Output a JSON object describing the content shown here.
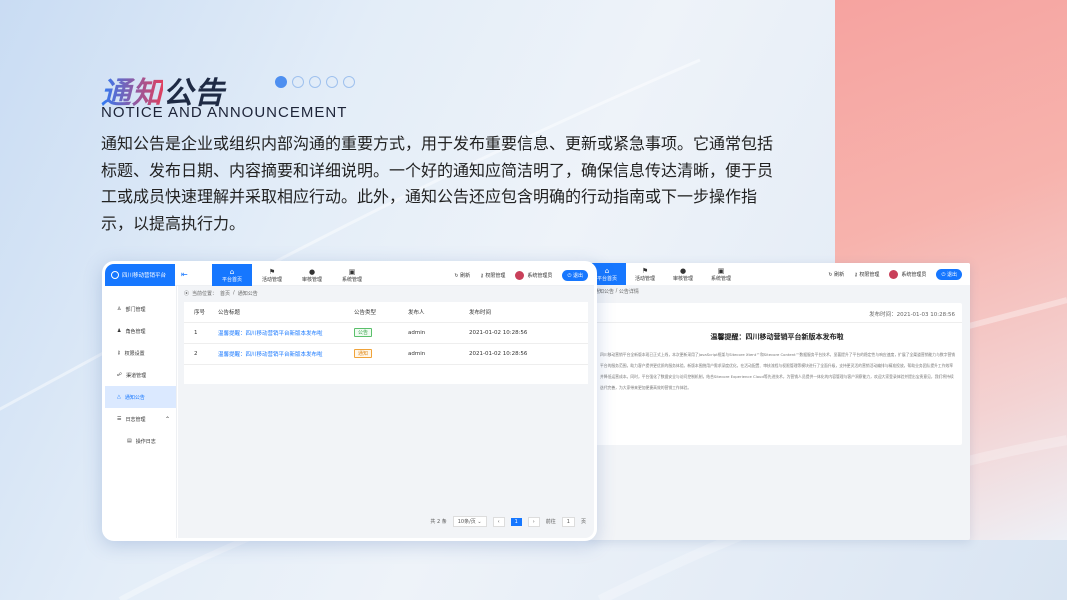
{
  "header": {
    "title_accent": "通知",
    "title_rest": "公告",
    "subtitle": "NOTICE AND ANNOUNCEMENT"
  },
  "description": "通知公告是企业或组织内部沟通的重要方式，用于发布重要信息、更新或紧急事项。它通常包括标题、发布日期、内容摘要和详细说明。一个好的通知应简洁明了，确保信息传达清晰，便于员工或成员快速理解并采取相应行动。此外，通知公告还应包含明确的行动指南或下一步操作指示，以提高执行力。",
  "app": {
    "logo": "四川移动营销平台",
    "nav": [
      {
        "label": "平台首页",
        "icon": "home-icon",
        "glyph": "⌂"
      },
      {
        "label": "活动管理",
        "icon": "flag-icon",
        "glyph": "⚑"
      },
      {
        "label": "审核管理",
        "icon": "user-icon",
        "glyph": "●"
      },
      {
        "label": "系统管理",
        "icon": "system-icon",
        "glyph": "▣"
      }
    ],
    "refresh": "刷新",
    "permission": "权限管理",
    "user": "系统管理员",
    "exit": "退出",
    "sidebar": [
      {
        "label": "部门管理",
        "icon": "org-icon",
        "glyph": "♙"
      },
      {
        "label": "角色管理",
        "icon": "role-icon",
        "glyph": "♟"
      },
      {
        "label": "权限设置",
        "icon": "key-icon",
        "glyph": "⚷"
      },
      {
        "label": "渠道管理",
        "icon": "channel-icon",
        "glyph": "☍"
      },
      {
        "label": "通知公告",
        "icon": "bell-icon",
        "glyph": "△"
      },
      {
        "label": "日志管理",
        "icon": "log-icon",
        "glyph": "☰"
      },
      {
        "label": "操作日志",
        "icon": "doc-icon",
        "glyph": "▤"
      }
    ],
    "breadcrumb": {
      "prefix": "当前位置：",
      "home": "首页",
      "sep": "/",
      "current": "通知公告",
      "detail": "公告详情"
    },
    "table": {
      "columns": [
        "序号",
        "公告标题",
        "公告类型",
        "发布人",
        "发布时间"
      ],
      "rows": [
        {
          "no": "1",
          "title": "温馨提醒：四川移动营销平台新版本发布啦",
          "type": "公告",
          "publisher": "admin",
          "time": "2021-01-02 10:28:56"
        },
        {
          "no": "2",
          "title": "温馨提醒：四川移动营销平台新版本发布啦",
          "type": "通知",
          "publisher": "admin",
          "time": "2021-01-02 10:28:56"
        }
      ]
    },
    "pager": {
      "total": "共 2 条",
      "size": "10条/页",
      "prev": "‹",
      "page": "1",
      "next": "›",
      "goto": "前往",
      "goto_page": "1",
      "goto_unit": "页"
    },
    "detail": {
      "pubtime": "发布时间：2021-01-03 10:28:56",
      "title": "温馨提醒：四川移动营销平台新版本发布啦",
      "body": "四川移动营销平台全新版本现已正式上线，本次更新采用了JavaScript框架与Sitecore Xtent™和Sitecore Content™数据服务平台技术，显著提升了平台的稳定性与响应速度，扩展了全渠道营销能力与数字营销平台的服务范围，助力客户提供更优质的服务体验。新版本围绕用户需求深度优化，在活动配置、审核流程与权限管理等模块进行了全面升级，支持更灵活的营销活动编排与精准投放，帮助业务团队提升工作效率并降低运营成本。同时，平台强化了数据安全与访问控制机制，结合Sitecore Experience Cloud等先进技术，为营销人员提供一体化的内容管理与客户洞察能力，欢迎大家登录体验并提出宝贵意见，我们将持续迭代完善，为大家带来更加便捷高效的营销工作体验。"
    }
  }
}
